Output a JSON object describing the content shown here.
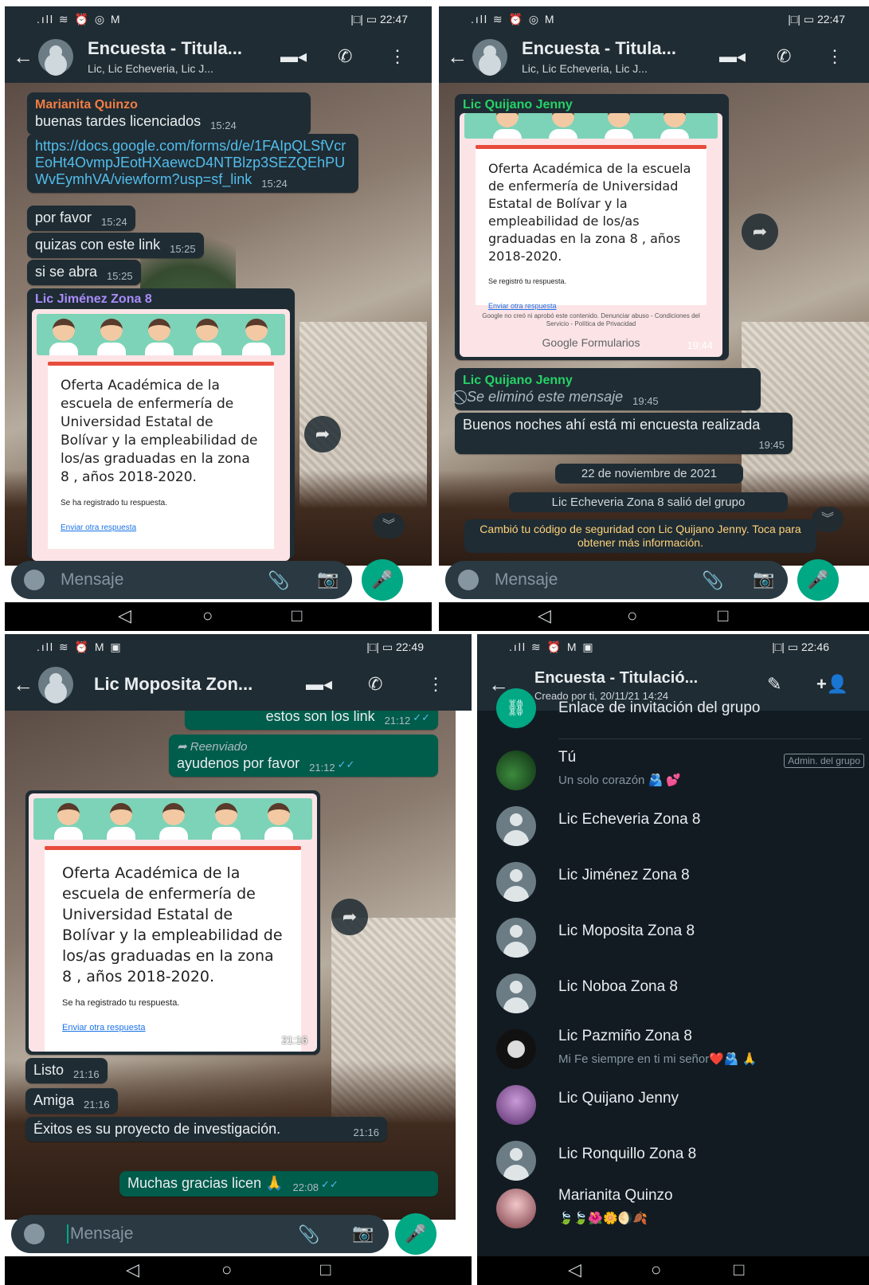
{
  "panel1": {
    "status": {
      "left": ".ıll ≋ ⏰ ◎ M",
      "right": "|□| ▭ 22:47"
    },
    "header": {
      "title": "Encuesta - Titula...",
      "subtitle": "Lic, Lic Echeveria, Lic J..."
    },
    "messages": {
      "m1_sender": "Marianita Quinzo",
      "m1_text": "buenas tardes licenciados",
      "m1_time": "15:24",
      "m2_text": "https://docs.google.com/forms/d/e/1FAIpQLSfVcrEoHt4OvmpJEotHXaewcD4NTBlzp3SEZQEhPUWvEymhVA/viewform?usp=sf_link",
      "m2_time": "15:24",
      "m3_text": "por favor",
      "m3_time": "15:24",
      "m4_text": "quizas con este link",
      "m4_time": "15:25",
      "m5_text": "si se abra",
      "m5_time": "15:25",
      "m6_sender": "Lic Jiménez Zona 8"
    },
    "form": {
      "title": "Oferta Académica de la escuela de enfermería de Universidad Estatal de Bolívar y la empleabilidad de los/as graduadas en la zona 8 , años 2018-2020.",
      "registered": "Se ha registrado tu respuesta.",
      "again": "Enviar otra respuesta"
    },
    "input_placeholder": "Mensaje"
  },
  "panel2": {
    "status": {
      "left": ".ıll ≋ ⏰ ◎ M",
      "right": "|□| ▭ 22:47"
    },
    "header": {
      "title": "Encuesta - Titula...",
      "subtitle": "Lic, Lic Echeveria, Lic J..."
    },
    "top_sender": "Lic Quijano Jenny",
    "form": {
      "title": "Oferta Académica de la escuela de enfermería de Universidad Estatal de Bolívar y la empleabilidad de los/as graduadas en la zona 8 , años 2018-2020.",
      "registered": "Se registró tu respuesta.",
      "again": "Enviar otra respuesta",
      "disclaimer": "Google no creó ni aprobó este contenido. Denunciar abuso - Condiciones del Servicio - Política de Privacidad",
      "logo": "Google Formularios",
      "time": "19:44"
    },
    "deleted_sender": "Lic Quijano Jenny",
    "deleted_text": "Se eliminó este mensaje",
    "deleted_time": "19:45",
    "m_text": "Buenos noches ahí está mi encuesta realizada",
    "m_time": "19:45",
    "date_chip": "22 de noviembre de 2021",
    "left_group": "Lic Echeveria Zona 8 salió del grupo",
    "security": "Cambió tu código de seguridad con Lic Quijano Jenny. Toca para obtener más información.",
    "input_placeholder": "Mensaje"
  },
  "panel3": {
    "status": {
      "left": ".ıll ≋ ⏰ M ▣",
      "right": "|□| ▭ 22:49"
    },
    "header": {
      "title": "Lic Moposita Zon..."
    },
    "o1_text": "estos son los link",
    "o1_time": "21:12",
    "o2_forwarded": "Reenviado",
    "o2_text": "ayudenos por favor",
    "o2_time": "21:12",
    "form": {
      "title": "Oferta Académica de la escuela de enfermería de Universidad Estatal de Bolívar y la empleabilidad de los/as graduadas en la zona 8 , años 2018-2020.",
      "registered": "Se ha registrado tu respuesta.",
      "again": "Enviar otra respuesta",
      "time": "21:16"
    },
    "i1_text": "Listo",
    "i1_time": "21:16",
    "i2_text": "Amiga",
    "i2_time": "21:16",
    "i3_text": "Éxitos es su proyecto de investigación.",
    "i3_time": "21:16",
    "o3_text": "Muchas gracias licen 🙏",
    "o3_time": "22:08",
    "input_placeholder": "Mensaje"
  },
  "panel4": {
    "status": {
      "left": ".ıll ≋ ⏰ M ▣",
      "right": "|□| ▭ 22:46"
    },
    "header": {
      "title": "Encuesta - Titulació...",
      "subtitle": "Creado por ti, 20/11/21 14:24"
    },
    "invite_link": "Enlace de invitación del grupo",
    "admin_badge": "Admin. del grupo",
    "members": [
      {
        "name": "Tú",
        "about": "Un solo corazón 🫂 💕"
      },
      {
        "name": "Lic Echeveria Zona 8"
      },
      {
        "name": "Lic Jiménez Zona 8"
      },
      {
        "name": "Lic Moposita Zona 8"
      },
      {
        "name": "Lic Noboa Zona 8"
      },
      {
        "name": "Lic Pazmiño Zona 8",
        "about": "Mi Fe siempre en ti mi señor❤️🫂 🙏"
      },
      {
        "name": "Lic Quijano Jenny"
      },
      {
        "name": "Lic Ronquillo Zona 8"
      },
      {
        "name": "Marianita Quinzo",
        "about": "🍃🍃🌺🌼🌖🍂"
      }
    ]
  },
  "colors": {
    "header": "#202c33",
    "bubble_in": "#1f2c34",
    "bubble_out": "#005c4b",
    "accent": "#00a884",
    "link": "#53bdeb",
    "sender_orange": "#f37d41",
    "sender_purple": "#a98dfb",
    "sender_teal": "#25d366"
  },
  "icons": [
    "back-arrow-icon",
    "group-avatar-icon",
    "video-call-icon",
    "voice-call-icon",
    "more-options-icon",
    "emoji-icon",
    "attach-icon",
    "camera-icon",
    "mic-icon",
    "forward-icon",
    "scroll-down-icon",
    "edit-icon",
    "add-member-icon",
    "link-icon",
    "deleted-icon"
  ]
}
